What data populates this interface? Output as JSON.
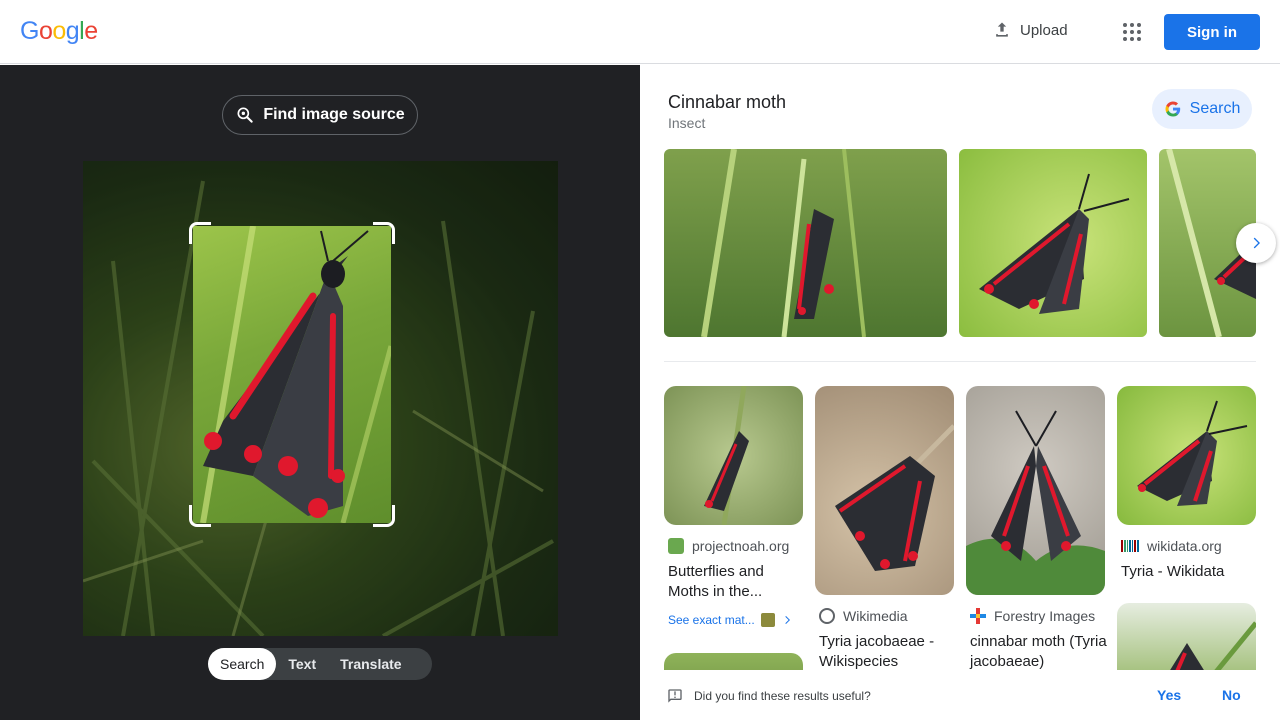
{
  "header": {
    "logo_letters": [
      {
        "ch": "G",
        "color": "#4285F4"
      },
      {
        "ch": "o",
        "color": "#EA4335"
      },
      {
        "ch": "o",
        "color": "#FBBC05"
      },
      {
        "ch": "g",
        "color": "#4285F4"
      },
      {
        "ch": "l",
        "color": "#34A853"
      },
      {
        "ch": "e",
        "color": "#EA4335"
      }
    ],
    "upload_label": "Upload",
    "apps_icon": "apps-grid-icon",
    "signin_label": "Sign in"
  },
  "lens": {
    "find_source_label": "Find image source",
    "modes": [
      "Search",
      "Text",
      "Translate"
    ],
    "active_mode": "Search"
  },
  "knowledge": {
    "title": "Cinnabar moth",
    "subtitle": "Insect",
    "search_label": "Search"
  },
  "results": [
    {
      "source": "projectnoah.org",
      "title": "Butterflies and Moths in the...",
      "favicon_color": "#6aa84f"
    },
    {
      "source": "Wikimedia",
      "title": "Tyria jacobaeae - Wikispecies",
      "favicon_color": "#5f6368"
    },
    {
      "source": "Forestry Images",
      "title": "cinnabar moth (Tyria jacobaeae)",
      "favicon_color": "#e53935"
    },
    {
      "source": "wikidata.org",
      "title": "Tyria - Wikidata",
      "favicon_color": "#990000"
    }
  ],
  "see_exact": "See exact mat...",
  "feedback": {
    "question": "Did you find these results useful?",
    "yes": "Yes",
    "no": "No"
  },
  "colors": {
    "accent": "#1a73e8",
    "dark_panel": "#202124",
    "moth_red": "#e0182d",
    "moth_black": "#2b2d33"
  }
}
